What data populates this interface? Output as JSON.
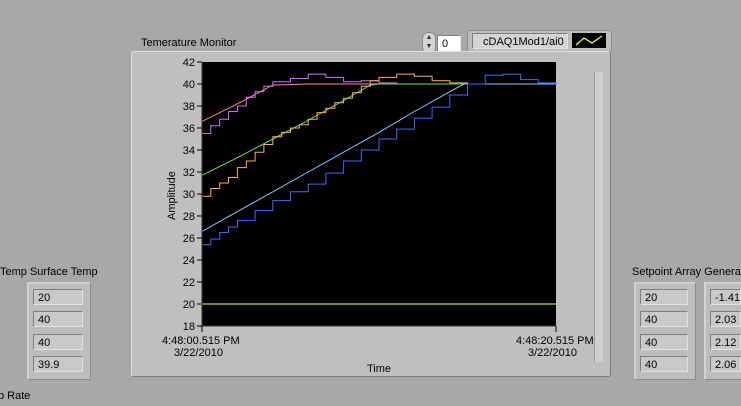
{
  "chart_title": "Temerature Monitor",
  "plot_index": "0",
  "legend": {
    "channel": "cDAQ1Mod1/ai0"
  },
  "left_panel": {
    "title": "Temp Surface Temp",
    "values": [
      "20",
      "40",
      "40",
      "39.9"
    ]
  },
  "right_panel": {
    "title": "Setpoint Array Genera",
    "setpoints": [
      "20",
      "40",
      "40",
      "40"
    ],
    "generated": [
      "-1.41",
      "2.03",
      "2.12",
      "2.06"
    ]
  },
  "bottom_label": "p Rate",
  "colors": {
    "plot_bg": "#000000",
    "series_pink": "#ff8a8a",
    "series_purple": "#d070ff",
    "series_green": "#66e066",
    "series_orange": "#ffb050",
    "series_lightblue": "#88c8ff",
    "series_blue": "#4466ff",
    "series_yellow": "#ffff40"
  },
  "chart_data": {
    "type": "line",
    "xlabel": "Time",
    "ylabel": "Amplitude",
    "ylim": [
      18,
      42
    ],
    "yticks": [
      18,
      20,
      22,
      24,
      26,
      28,
      30,
      32,
      34,
      36,
      38,
      40,
      42
    ],
    "x_start_time": "4:48:00.515 PM",
    "x_start_date": "3/22/2010",
    "x_end_time": "4:48:20.515 PM",
    "x_end_date": "3/22/2010",
    "xlim": [
      0,
      20
    ],
    "series": [
      {
        "color": "#ff8a8a",
        "step": false,
        "points": [
          [
            0,
            36.6
          ],
          [
            2,
            38.2
          ],
          [
            4,
            39.9
          ],
          [
            6,
            40
          ],
          [
            20,
            40
          ]
        ]
      },
      {
        "color": "#d070ff",
        "step": true,
        "points": [
          [
            0,
            35.5
          ],
          [
            0.5,
            36.2
          ],
          [
            1,
            36.8
          ],
          [
            1.5,
            37.5
          ],
          [
            2,
            38.0
          ],
          [
            2.5,
            38.8
          ],
          [
            3,
            39.3
          ],
          [
            3.5,
            39.8
          ],
          [
            4,
            40.2
          ],
          [
            5,
            40.5
          ],
          [
            6,
            40.9
          ],
          [
            7,
            40.6
          ],
          [
            8,
            40.2
          ],
          [
            9,
            40.3
          ],
          [
            10,
            40.1
          ],
          [
            11,
            40.0
          ],
          [
            20,
            40.0
          ]
        ]
      },
      {
        "color": "#66e066",
        "step": false,
        "points": [
          [
            0,
            31.7
          ],
          [
            2,
            33.3
          ],
          [
            4,
            35.0
          ],
          [
            6,
            36.7
          ],
          [
            8,
            38.5
          ],
          [
            9.5,
            39.9
          ],
          [
            10,
            40
          ],
          [
            20,
            40
          ]
        ]
      },
      {
        "color": "#ffb050",
        "step": true,
        "points": [
          [
            0,
            29.8
          ],
          [
            0.5,
            30.5
          ],
          [
            1,
            31.0
          ],
          [
            1.5,
            31.5
          ],
          [
            2,
            32.4
          ],
          [
            2.5,
            33.0
          ],
          [
            3,
            33.8
          ],
          [
            3.5,
            34.5
          ],
          [
            4,
            35.2
          ],
          [
            4.5,
            35.6
          ],
          [
            5,
            36.0
          ],
          [
            5.5,
            36.3
          ],
          [
            6,
            36.8
          ],
          [
            6.5,
            37.4
          ],
          [
            7,
            37.8
          ],
          [
            7.5,
            38.3
          ],
          [
            8,
            38.7
          ],
          [
            8.5,
            39.2
          ],
          [
            9,
            39.8
          ],
          [
            9.5,
            40.3
          ],
          [
            10,
            40.6
          ],
          [
            11,
            40.9
          ],
          [
            12,
            40.7
          ],
          [
            13,
            40.3
          ],
          [
            14,
            40.1
          ],
          [
            15,
            40.0
          ],
          [
            20,
            40.0
          ]
        ]
      },
      {
        "color": "#88c8ff",
        "step": false,
        "points": [
          [
            0,
            26.6
          ],
          [
            2,
            28.4
          ],
          [
            4,
            30.2
          ],
          [
            6,
            32.0
          ],
          [
            8,
            33.8
          ],
          [
            10,
            35.6
          ],
          [
            12,
            37.5
          ],
          [
            14,
            39.3
          ],
          [
            14.8,
            40
          ],
          [
            20,
            40
          ]
        ]
      },
      {
        "color": "#4466ff",
        "step": true,
        "points": [
          [
            0,
            25.4
          ],
          [
            0.5,
            25.9
          ],
          [
            1,
            26.5
          ],
          [
            1.5,
            27.0
          ],
          [
            2,
            27.6
          ],
          [
            3,
            28.5
          ],
          [
            4,
            29.4
          ],
          [
            5,
            30.2
          ],
          [
            6,
            30.9
          ],
          [
            7,
            31.9
          ],
          [
            8,
            33.0
          ],
          [
            9,
            34.0
          ],
          [
            10,
            35.0
          ],
          [
            11,
            35.9
          ],
          [
            12,
            36.9
          ],
          [
            13,
            37.9
          ],
          [
            14,
            39.0
          ],
          [
            15,
            40.0
          ],
          [
            16,
            40.8
          ],
          [
            17,
            40.9
          ],
          [
            18,
            40.4
          ],
          [
            19,
            40.1
          ],
          [
            20,
            40.0
          ]
        ]
      },
      {
        "color": "#ffff40",
        "step": false,
        "points": [
          [
            0,
            20
          ],
          [
            20,
            20
          ]
        ]
      }
    ]
  }
}
